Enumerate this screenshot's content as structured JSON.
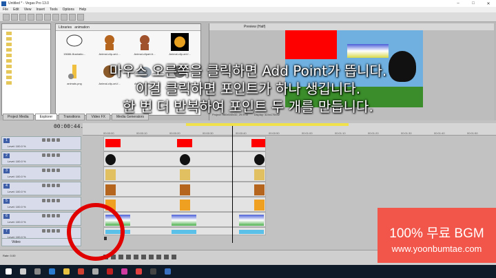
{
  "window": {
    "title": "Untitled * - Vegas Pro 13.0"
  },
  "menu": [
    "File",
    "Edit",
    "View",
    "Insert",
    "Tools",
    "Options",
    "Help"
  ],
  "media_panel": {
    "tabs": [
      "Libraries",
      "animation"
    ],
    "items": [
      {
        "caption": "15686-Illustratio..."
      },
      {
        "caption": "Animal-clip-art-l..."
      },
      {
        "caption": "Animal-clipart-fr..."
      },
      {
        "caption": "Animal-clip-art-f..."
      },
      {
        "caption": "animals.png"
      },
      {
        "caption": "Animal-clip-art-f..."
      },
      {
        "caption": "Animal-clipart-f..."
      },
      {
        "caption": "1968x2510x32, PNG"
      }
    ]
  },
  "bottom_tabs": [
    "Project Media",
    "Explorer",
    "Transitions",
    "Video FX",
    "Media Generators"
  ],
  "preview": {
    "label": "Preview (Half)",
    "project_info": "Project: 960x540x32, 29.970i",
    "display_info": "Display: 324x175x32"
  },
  "timeline": {
    "timecode": "00:00:44.23",
    "ruler_ticks": [
      "00:00:00",
      "00:00:10",
      "00:00:20",
      "00:00:30",
      "00:00:40",
      "00:00:50",
      "00:01:00",
      "00:01:10",
      "00:01:20",
      "00:01:30",
      "00:01:40",
      "00:01:50"
    ],
    "tracks": [
      {
        "num": "1",
        "level": "Level: 100.0 %"
      },
      {
        "num": "2",
        "level": "Level: 100.0 %"
      },
      {
        "num": "3",
        "level": "Level: 100.0 %"
      },
      {
        "num": "4",
        "level": "Level: 100.0 %"
      },
      {
        "num": "5",
        "level": "Level: 100.0 %"
      },
      {
        "num": "6",
        "level": "Level: 100.0 %"
      },
      {
        "num": "7",
        "level": "Level: 100.0 %"
      }
    ],
    "video_track_label": "Video",
    "rate_label": "Rate: 0.00"
  },
  "overlay": {
    "subtitle_lines": [
      "마우스 오른쪽을 클릭하면 Add Point가 뜹니다.",
      "이걸 클릭하면 포인트가 하나 생깁니다.",
      "한 번 더 반복하여 포인트 두 개를 만듭니다."
    ],
    "badge_line1": "100% 무료 BGM",
    "badge_line2": "www.yoonbumtae.com"
  },
  "colors": {
    "subtitle": "#ffffff",
    "circle": "#e00000",
    "badge": "#f2564a"
  }
}
